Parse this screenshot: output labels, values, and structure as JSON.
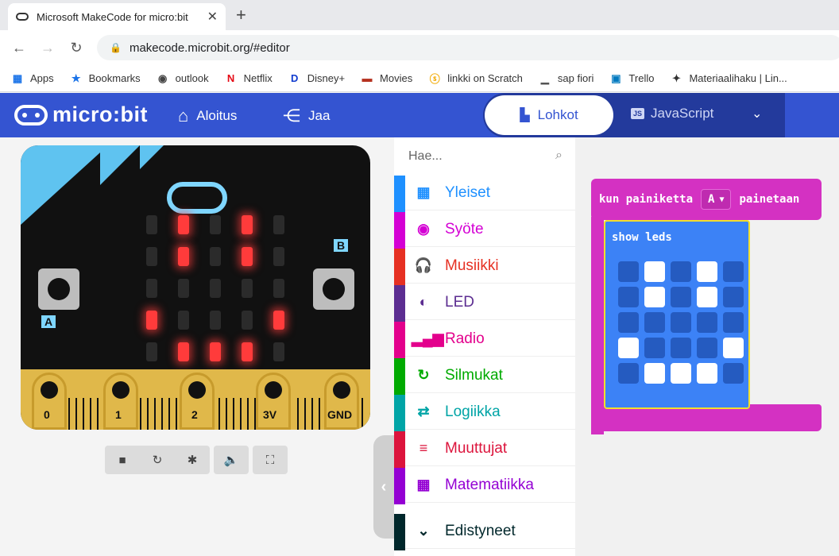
{
  "browser": {
    "tab_title": "Microsoft MakeCode for micro:bit",
    "url": "makecode.microbit.org/#editor",
    "bookmarks": [
      {
        "icon": "apps-icon",
        "glyph": "▦",
        "label": "Apps",
        "color": "#1a73e8"
      },
      {
        "icon": "star-icon",
        "glyph": "★",
        "label": "Bookmarks",
        "color": "#1a73e8"
      },
      {
        "icon": "globe-icon",
        "glyph": "◉",
        "label": "outlook",
        "color": "#444"
      },
      {
        "icon": "netflix-icon",
        "glyph": "N",
        "label": "Netflix",
        "color": "#e50914"
      },
      {
        "icon": "disney-icon",
        "glyph": "D",
        "label": "Disney+",
        "color": "#113ccf"
      },
      {
        "icon": "movies-icon",
        "glyph": "▬",
        "label": "Movies",
        "color": "#b5321f"
      },
      {
        "icon": "scratch-icon",
        "glyph": "ⓢ",
        "label": "linkki on Scratch",
        "color": "#f2a900"
      },
      {
        "icon": "sap-icon",
        "glyph": "▁",
        "label": "sap fiori",
        "color": "#555"
      },
      {
        "icon": "trello-icon",
        "glyph": "▣",
        "label": "Trello",
        "color": "#0079bf"
      },
      {
        "icon": "materiaali-icon",
        "glyph": "✦",
        "label": "Materiaalihaku | Lin...",
        "color": "#333"
      }
    ]
  },
  "header": {
    "brand": "micro:bit",
    "home_label": "Aloitus",
    "share_label": "Jaa",
    "blocks_label": "Lohkot",
    "js_label": "JavaScript",
    "js_badge": "JS"
  },
  "simulator": {
    "button_a": "A",
    "button_b": "B",
    "pins": [
      "0",
      "1",
      "2",
      "3V",
      "GND"
    ],
    "leds": [
      [
        0,
        1,
        0,
        1,
        0
      ],
      [
        0,
        1,
        0,
        1,
        0
      ],
      [
        0,
        0,
        0,
        0,
        0
      ],
      [
        1,
        0,
        0,
        0,
        1
      ],
      [
        0,
        1,
        1,
        1,
        0
      ]
    ]
  },
  "toolbox": {
    "search_placeholder": "Hae...",
    "categories": [
      {
        "label": "Yleiset",
        "icon": "grid-icon",
        "glyph": "▦",
        "color": "#1e90ff"
      },
      {
        "label": "Syöte",
        "icon": "target-icon",
        "glyph": "◉",
        "color": "#d400d4"
      },
      {
        "label": "Musiikki",
        "icon": "headphones-icon",
        "glyph": "🎧",
        "color": "#e63022"
      },
      {
        "label": "LED",
        "icon": "toggle-icon",
        "glyph": "◐",
        "color": "#5c2d91"
      },
      {
        "label": "Radio",
        "icon": "signal-icon",
        "glyph": "▂▄▆",
        "color": "#e3008c"
      },
      {
        "label": "Silmukat",
        "icon": "loop-icon",
        "glyph": "↻",
        "color": "#00aa00"
      },
      {
        "label": "Logiikka",
        "icon": "shuffle-icon",
        "glyph": "⇄",
        "color": "#00a4a6"
      },
      {
        "label": "Muuttujat",
        "icon": "lines-icon",
        "glyph": "≡",
        "color": "#dc143c"
      },
      {
        "label": "Matematiikka",
        "icon": "calculator-icon",
        "glyph": "▦",
        "color": "#9400d3"
      },
      {
        "label": "Edistyneet",
        "icon": "chevron-down-icon",
        "glyph": "⌄",
        "color": "#00272b"
      }
    ]
  },
  "workspace": {
    "event_prefix": "kun painiketta",
    "event_button": "A",
    "event_suffix": "painetaan",
    "show_leds_label": "show leds",
    "show_leds_grid": [
      [
        0,
        1,
        0,
        1,
        0
      ],
      [
        0,
        1,
        0,
        1,
        0
      ],
      [
        0,
        0,
        0,
        0,
        0
      ],
      [
        1,
        0,
        0,
        0,
        1
      ],
      [
        0,
        1,
        1,
        1,
        0
      ]
    ]
  }
}
